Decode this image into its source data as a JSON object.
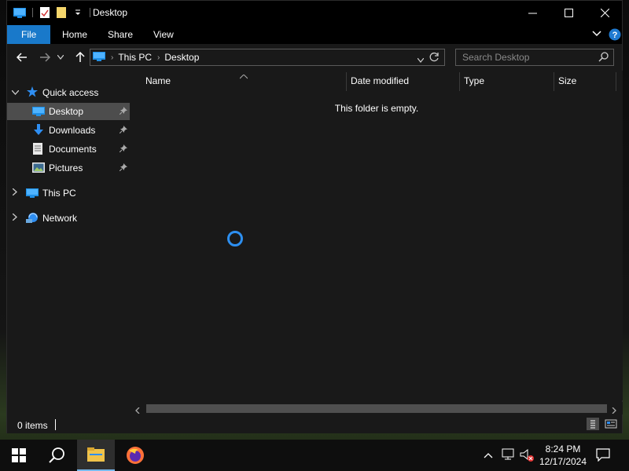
{
  "window": {
    "title": "Desktop",
    "controls": {
      "minimize": "—",
      "maximize": "☐",
      "close": "✕"
    }
  },
  "ribbon": {
    "tabs": [
      {
        "label": "File"
      },
      {
        "label": "Home"
      },
      {
        "label": "Share"
      },
      {
        "label": "View"
      }
    ]
  },
  "address": {
    "crumbs": [
      "This PC",
      "Desktop"
    ],
    "search_placeholder": "Search Desktop"
  },
  "nav": {
    "quick_access": "Quick access",
    "items": [
      {
        "label": "Desktop",
        "icon": "desktop-icon",
        "pinned": true,
        "selected": true
      },
      {
        "label": "Downloads",
        "icon": "downloads-icon",
        "pinned": true
      },
      {
        "label": "Documents",
        "icon": "documents-icon",
        "pinned": true
      },
      {
        "label": "Pictures",
        "icon": "pictures-icon",
        "pinned": true
      }
    ],
    "this_pc": "This PC",
    "network": "Network"
  },
  "columns": {
    "name": "Name",
    "date_modified": "Date modified",
    "type": "Type",
    "size": "Size"
  },
  "content": {
    "empty_message": "This folder is empty."
  },
  "status": {
    "items": "0 items"
  },
  "taskbar": {
    "time": "8:24 PM",
    "date": "12/17/2024"
  },
  "colors": {
    "accent": "#1979ca",
    "selection": "#4d4d4d",
    "spinner": "#2d8ff0"
  }
}
